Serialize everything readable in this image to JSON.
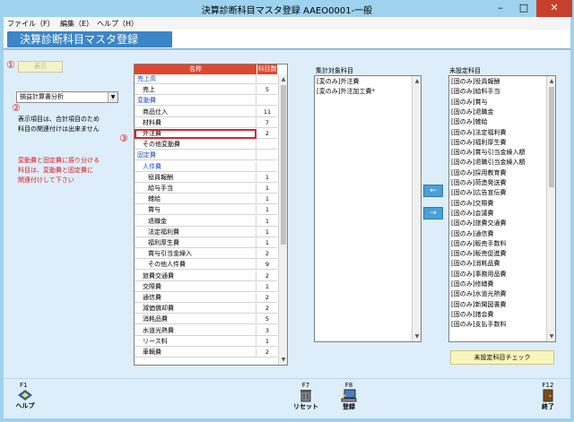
{
  "window": {
    "title": "決算診断科目マスタ登録 AAEO0001-一般",
    "minimize": "–",
    "maximize": "□",
    "close": "✕"
  },
  "menu": [
    "ファイル（F）",
    "編集（E）",
    "ヘルプ（H）"
  ],
  "banner": "決算診断科目マスタ登録",
  "markers": {
    "m1": "①",
    "m2": "②",
    "m3": "③"
  },
  "display_button": "表示",
  "report_select": {
    "value": "損益計算書分析"
  },
  "notes": {
    "info": [
      "表示項目は、合計項目のため",
      "科目の関連付けは出来ません"
    ],
    "warning": [
      "変動費と固定費に振り分ける",
      "科目は、変動費と固定費に",
      "関連付けして下さい"
    ]
  },
  "grid": {
    "col_name": "名称",
    "col_count": "科目数",
    "rows": [
      {
        "name": "売上高",
        "count": "",
        "level": 0,
        "cat": true
      },
      {
        "name": "売上",
        "count": "5",
        "level": 1,
        "cat": false
      },
      {
        "name": "変動費",
        "count": "",
        "level": 0,
        "cat": true
      },
      {
        "name": "商品仕入",
        "count": "11",
        "level": 1,
        "cat": false
      },
      {
        "name": "材料費",
        "count": "7",
        "level": 1,
        "cat": false
      },
      {
        "name": "外注費",
        "count": "2",
        "level": 1,
        "cat": false,
        "selected": true
      },
      {
        "name": "その他変動費",
        "count": "",
        "level": 1,
        "cat": false
      },
      {
        "name": "固定費",
        "count": "",
        "level": 0,
        "cat": true
      },
      {
        "name": "人件費",
        "count": "",
        "level": 1,
        "cat": true
      },
      {
        "name": "役員報酬",
        "count": "1",
        "level": 2,
        "cat": false
      },
      {
        "name": "給与手当",
        "count": "1",
        "level": 2,
        "cat": false
      },
      {
        "name": "雑給",
        "count": "1",
        "level": 2,
        "cat": false
      },
      {
        "name": "賞与",
        "count": "1",
        "level": 2,
        "cat": false
      },
      {
        "name": "退職金",
        "count": "1",
        "level": 2,
        "cat": false
      },
      {
        "name": "法定福利費",
        "count": "1",
        "level": 2,
        "cat": false
      },
      {
        "name": "福利厚生費",
        "count": "1",
        "level": 2,
        "cat": false
      },
      {
        "name": "賞与引当金繰入",
        "count": "2",
        "level": 2,
        "cat": false
      },
      {
        "name": "その他人件費",
        "count": "9",
        "level": 2,
        "cat": false
      },
      {
        "name": "旅費交通費",
        "count": "2",
        "level": 1,
        "cat": false
      },
      {
        "name": "交際費",
        "count": "1",
        "level": 1,
        "cat": false
      },
      {
        "name": "通信費",
        "count": "2",
        "level": 1,
        "cat": false
      },
      {
        "name": "減価償却費",
        "count": "2",
        "level": 1,
        "cat": false
      },
      {
        "name": "消耗品費",
        "count": "5",
        "level": 1,
        "cat": false
      },
      {
        "name": "水道光熱費",
        "count": "3",
        "level": 1,
        "cat": false
      },
      {
        "name": "リース料",
        "count": "1",
        "level": 1,
        "cat": false
      },
      {
        "name": "車輌費",
        "count": "2",
        "level": 1,
        "cat": false
      }
    ]
  },
  "assigned": {
    "label": "集計対象科目",
    "items": [
      "[変のみ]外注費",
      "[変のみ]外注加工費*"
    ]
  },
  "unassigned": {
    "label": "未設定科目",
    "items": [
      "[固のみ]役員報酬",
      "[固のみ]給料手当",
      "[固のみ]賞与",
      "[固のみ]退職金",
      "[固のみ]雑給",
      "[固のみ]法定福利費",
      "[固のみ]福利厚生費",
      "[固のみ]賞与引当金繰入額",
      "[固のみ]退職引当金繰入額",
      "[固のみ]採用教育費",
      "[固のみ]荷造発送費",
      "[固のみ]広告宣伝費",
      "[固のみ]交際費",
      "[固のみ]会議費",
      "[固のみ]旅費交通費",
      "[固のみ]通信費",
      "[固のみ]販売手数料",
      "[固のみ]販売促進費",
      "[固のみ]消耗品費",
      "[固のみ]事務用品費",
      "[固のみ]修繕費",
      "[固のみ]水道光熱費",
      "[固のみ]新聞図書費",
      "[固のみ]諸会費",
      "[固のみ]支払手数料"
    ]
  },
  "move_buttons": {
    "to_unassigned": "→",
    "to_assigned": "←"
  },
  "check_button": "未設定科目チェック",
  "fkeys": [
    {
      "key": "F1",
      "label": "ヘルプ"
    },
    {
      "key": "F7",
      "label": "リセット"
    },
    {
      "key": "F8",
      "label": "登録"
    },
    {
      "key": "F12",
      "label": "終了"
    }
  ],
  "colors": {
    "accent": "#3b85c8",
    "header": "#e0462e",
    "marker": "#e01a1a",
    "category": "#1a4ec9"
  }
}
